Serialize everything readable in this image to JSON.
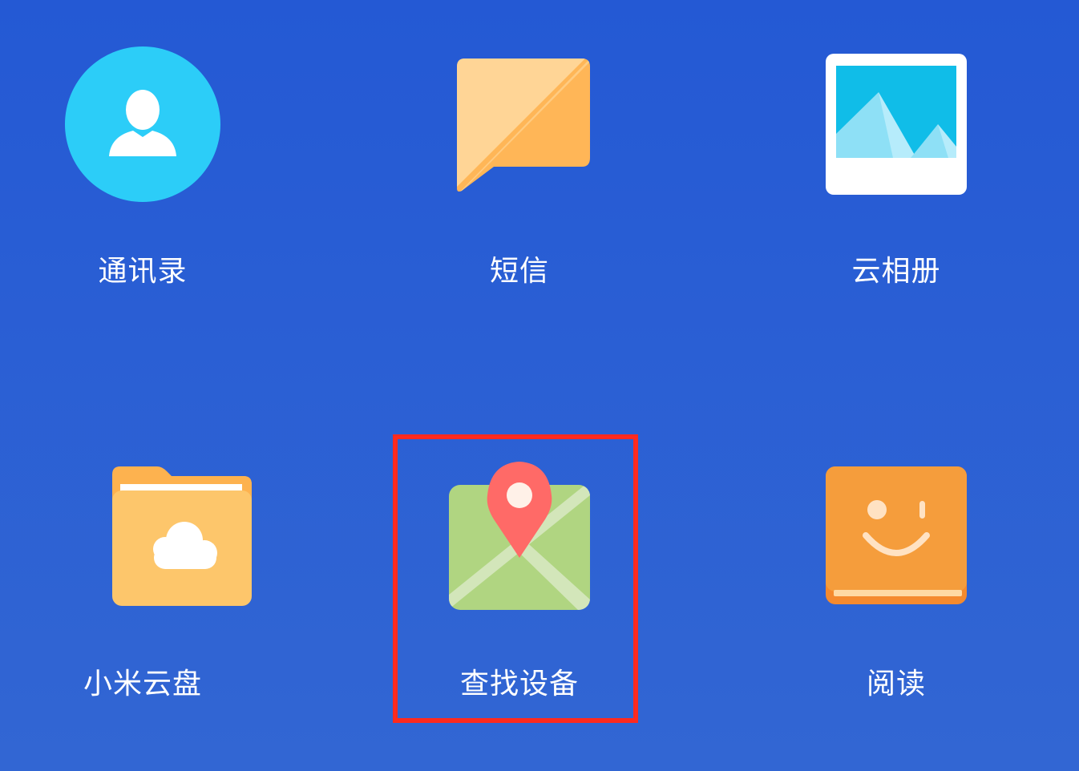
{
  "apps": [
    {
      "label": "通讯录",
      "icon": "contacts-icon"
    },
    {
      "label": "短信",
      "icon": "message-icon"
    },
    {
      "label": "云相册",
      "icon": "gallery-icon"
    },
    {
      "label": "小米云盘",
      "icon": "cloud-drive-icon"
    },
    {
      "label": "查找设备",
      "icon": "find-device-icon"
    },
    {
      "label": "阅读",
      "icon": "reading-icon"
    }
  ],
  "highlight": {
    "target": "find-device",
    "color": "#ff2a1f"
  },
  "colors": {
    "background": "#2a5fd3",
    "contacts": "#2ccdf8",
    "message_light": "#ffd596",
    "message_dark": "#ffb657",
    "gallery_sky": "#10bde8",
    "cloud_folder": "#fdc66b",
    "map_green": "#b0d581",
    "pin_red": "#ff6a67",
    "reading_orange": "#f59d3c"
  }
}
